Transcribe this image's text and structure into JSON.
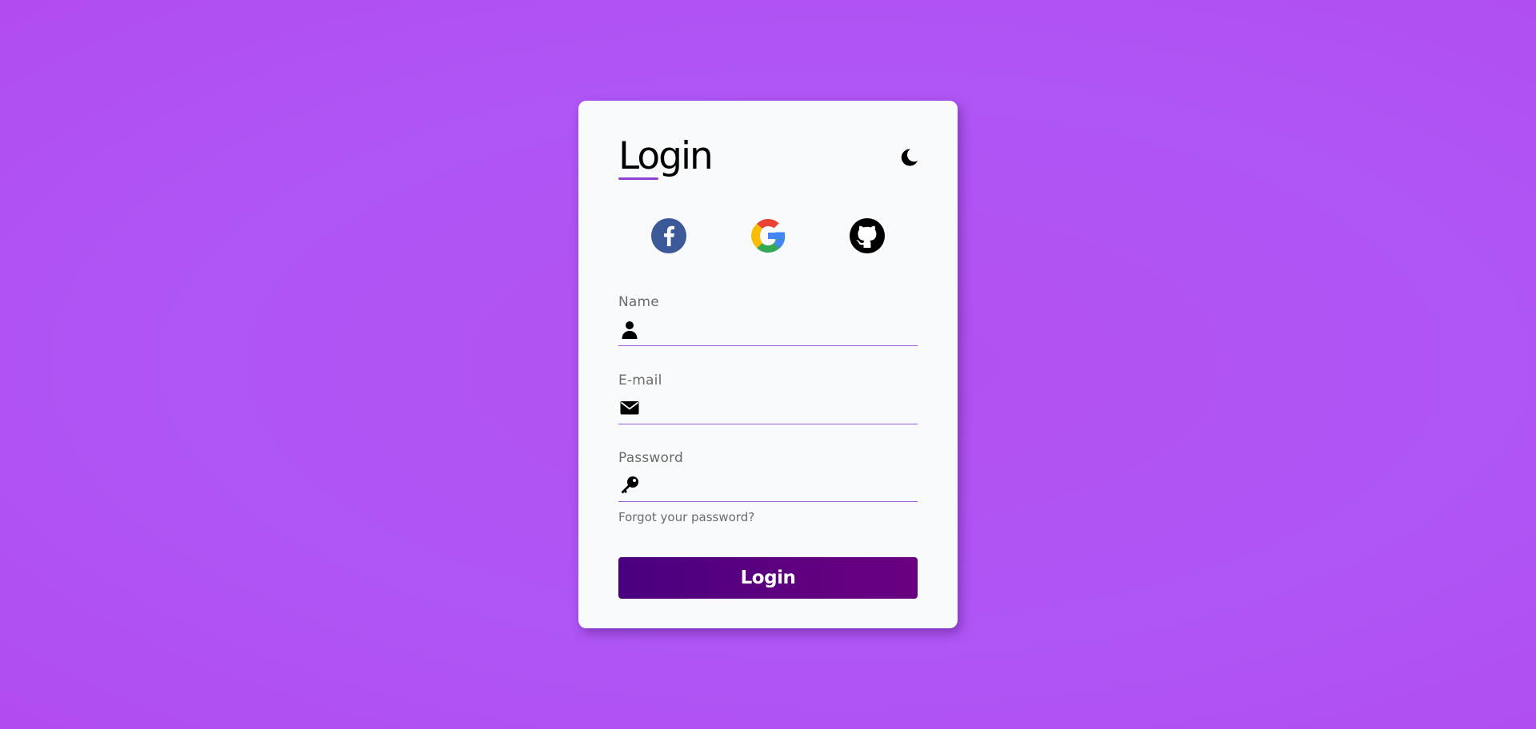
{
  "login_card": {
    "title": "Login",
    "theme_toggle_icon": "moon-icon",
    "social": [
      {
        "name": "Facebook",
        "icon": "facebook-icon",
        "color": "#3b5998"
      },
      {
        "name": "Google",
        "icon": "google-icon",
        "color": "#4285f4"
      },
      {
        "name": "GitHub",
        "icon": "github-icon",
        "color": "#000000"
      }
    ],
    "fields": {
      "name": {
        "label": "Name",
        "value": "",
        "icon": "user-icon"
      },
      "email": {
        "label": "E-mail",
        "value": "",
        "icon": "envelope-icon"
      },
      "password": {
        "label": "Password",
        "value": "",
        "icon": "key-icon"
      }
    },
    "forgot_password": "Forgot your password?",
    "submit_label": "Login"
  },
  "colors": {
    "background": "#b052f4",
    "accent": "#8e3fd4",
    "button_start": "#48007f",
    "button_end": "#690080"
  }
}
